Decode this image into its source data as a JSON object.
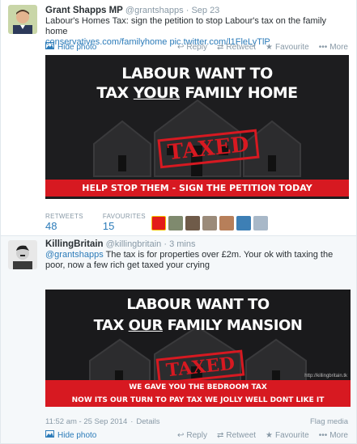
{
  "tweet1": {
    "fullname": "Grant Shapps MP",
    "handle": "@grantshapps",
    "separator": "·",
    "date": "Sep 23",
    "text": "Labour's Homes Tax: sign the petition to stop Labour's tax on the family home",
    "link1": "conservatives.com/familyhome",
    "link2": "pic.twitter.com/l1FleLyTlP",
    "hide_photo": "Hide photo",
    "reply": "Reply",
    "retweet": "Retweet",
    "favourite": "Favourite",
    "more": "More",
    "image": {
      "line1": "LABOUR WANT TO",
      "line2_pre": "TAX ",
      "line2_em": "YOUR",
      "line2_post": " FAMILY HOME",
      "stamp": "TAXED",
      "banner": "HELP STOP THEM  - SIGN THE PETITION TODAY"
    },
    "stats": {
      "retweets_label": "RETWEETS",
      "retweets_count": "48",
      "favourites_label": "FAVOURITES",
      "favourites_count": "15"
    }
  },
  "tweet2": {
    "fullname": "KillingBritain",
    "handle": "@killingbritain",
    "separator": "·",
    "date": "3 mins",
    "mention": "@grantshapps",
    "text": " The tax is for properties over £2m. Your ok with taxing the poor, now a few rich get taxed your crying",
    "image": {
      "line1": "LABOUR WANT TO",
      "line2_pre": "TAX ",
      "line2_em": "OUR",
      "line2_post": " FAMILY MANSION",
      "stamp": "TAXED",
      "watermark": "http://killingbritain.tk",
      "banner1": "WE GAVE YOU THE BEDROOM TAX",
      "banner2": "NOW ITS OUR TURN TO PAY TAX WE JOLLY WELL DONT LIKE IT"
    },
    "timestamp": "11:52 am - 25 Sep 2014",
    "details": "Details",
    "flag_media": "Flag media",
    "hide_photo": "Hide photo",
    "reply": "Reply",
    "retweet": "Retweet",
    "favourite": "Favourite",
    "more": "More"
  },
  "colors": {
    "link": "#2b7bb9",
    "muted": "#8899a6",
    "labour_red": "#d71921"
  }
}
